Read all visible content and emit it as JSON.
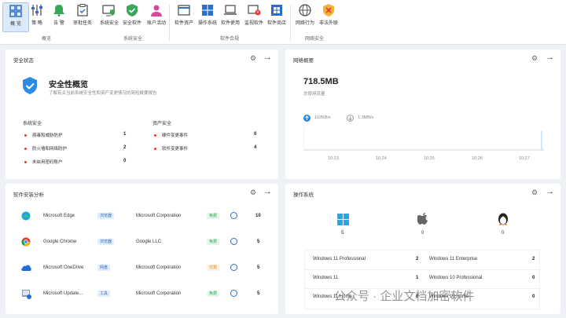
{
  "ribbon": {
    "buttons": [
      {
        "label": "概 览",
        "icon": "dashboard-icon"
      },
      {
        "label": "策 略",
        "icon": "sliders-icon"
      },
      {
        "label": "告 警",
        "icon": "bell-icon"
      },
      {
        "label": "审批任务",
        "icon": "clipboard-check-icon"
      },
      {
        "label": "系统安全",
        "icon": "monitor-shield-icon"
      },
      {
        "label": "安全软件",
        "icon": "shield-check-icon"
      },
      {
        "label": "账户活动",
        "icon": "user-icon"
      },
      {
        "label": "软件资产",
        "icon": "window-icon"
      },
      {
        "label": "操作系统",
        "icon": "windows-logo-icon"
      },
      {
        "label": "软件使用",
        "icon": "laptop-icon"
      },
      {
        "label": "监视软件",
        "icon": "monitor-alert-icon"
      },
      {
        "label": "软件商店",
        "icon": "store-icon"
      },
      {
        "label": "网络行为",
        "icon": "globe-icon"
      },
      {
        "label": "非法外联",
        "icon": "shield-cross-icon"
      }
    ],
    "groups": [
      "概览",
      "系统安全",
      "软件合规",
      "网络安全"
    ]
  },
  "security": {
    "title": "安全状态",
    "summary_title": "安全性概览",
    "summary_desc": "了解有关当前系统安全性和资产变更情况的简短概要报告",
    "sys_header": "系统安全",
    "asset_header": "资产安全",
    "sys_items": [
      {
        "label": "病毒和威胁防护",
        "value": "1"
      },
      {
        "label": "防火墙和网络防护",
        "value": "2"
      },
      {
        "label": "未启用密码账户",
        "value": "0"
      }
    ],
    "asset_items": [
      {
        "label": "硬件变更事件",
        "value": "0"
      },
      {
        "label": "软件变更事件",
        "value": "4"
      }
    ]
  },
  "network": {
    "title": "网络概要",
    "total": "718.5MB",
    "total_label": "总使用流量",
    "upload": "102KB/s",
    "download": "1.3MB/s",
    "times": [
      "10:23",
      "10:24",
      "10:25",
      "10:26",
      "10:27"
    ]
  },
  "software": {
    "title": "软件安装分析",
    "rows": [
      {
        "name": "Microsoft Edge",
        "cat": "浏览器",
        "vendor": "Microsoft Corporation",
        "license": "免费",
        "count": "10",
        "icon": "edge-icon"
      },
      {
        "name": "Google Chrome",
        "cat": "浏览器",
        "vendor": "Google LLC",
        "license": "免费",
        "count": "5",
        "icon": "chrome-icon"
      },
      {
        "name": "Microsoft OneDrive",
        "cat": "网盘",
        "vendor": "Microsoft Corporation",
        "license": "付费",
        "count": "5",
        "icon": "onedrive-icon"
      },
      {
        "name": "Microsoft Update...",
        "cat": "工具",
        "vendor": "Microsoft Corporation",
        "license": "免费",
        "count": "5",
        "icon": "update-icon"
      }
    ]
  },
  "os": {
    "title": "操作系统",
    "platforms": [
      {
        "name": "windows-logo-icon",
        "count": "5"
      },
      {
        "name": "apple-logo-icon",
        "count": "0"
      },
      {
        "name": "linux-penguin-icon",
        "count": "0"
      }
    ],
    "versions": [
      {
        "label": "Windows 11 Professional",
        "value": "2"
      },
      {
        "label": "Windows 11 Enterprise",
        "value": "2"
      },
      {
        "label": "Windows 11",
        "value": "1"
      },
      {
        "label": "Windows 10 Professional",
        "value": "0"
      },
      {
        "label": "Windows 11 Home",
        "value": "0"
      },
      {
        "label": "Windows 10 Home",
        "value": "0"
      }
    ]
  },
  "watermark": "公众号 · 企业文档加密软件",
  "colors": {
    "accent": "#2b6fc9",
    "danger": "#e53935",
    "upload": "#1e88e5",
    "download": "#9e9e9e"
  }
}
